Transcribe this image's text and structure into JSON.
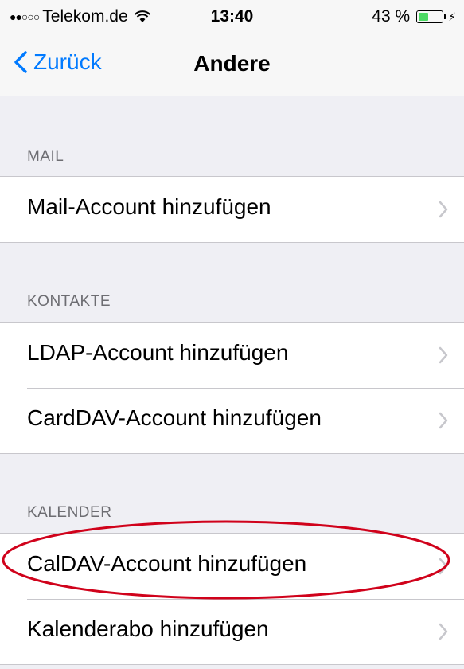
{
  "status_bar": {
    "signal_dots": "●●○○○",
    "carrier": "Telekom.de",
    "time": "13:40",
    "battery_percent": "43 %",
    "battery_level": 0.43,
    "charging_icon": "bolt-icon"
  },
  "nav": {
    "back_label": "Zurück",
    "title": "Andere"
  },
  "sections": {
    "mail": {
      "header": "MAIL",
      "items": [
        {
          "label": "Mail-Account hinzufügen"
        }
      ]
    },
    "contacts": {
      "header": "KONTAKTE",
      "items": [
        {
          "label": "LDAP-Account hinzufügen"
        },
        {
          "label": "CardDAV-Account hinzufügen"
        }
      ]
    },
    "calendar": {
      "header": "KALENDER",
      "items": [
        {
          "label": "CalDAV-Account hinzufügen"
        },
        {
          "label": "Kalenderabo hinzufügen"
        }
      ]
    }
  },
  "colors": {
    "accent": "#007aff",
    "highlight": "#d0021b",
    "battery": "#4cd964"
  }
}
